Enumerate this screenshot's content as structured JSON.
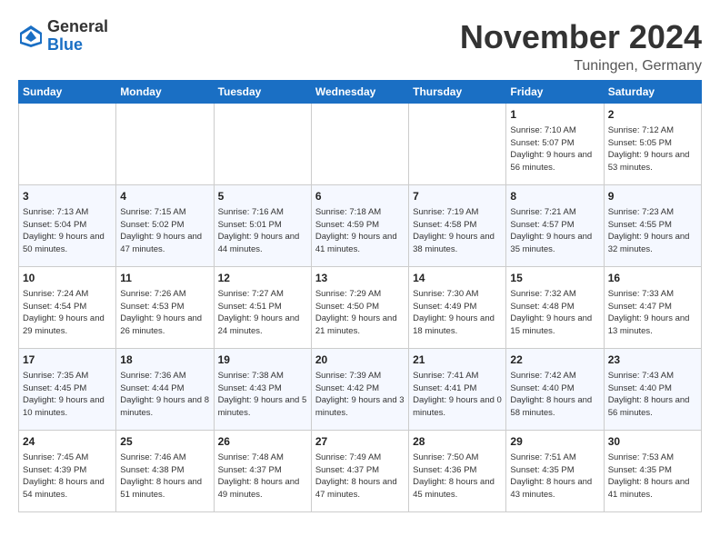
{
  "logo": {
    "general": "General",
    "blue": "Blue"
  },
  "title": "November 2024",
  "location": "Tuningen, Germany",
  "days_of_week": [
    "Sunday",
    "Monday",
    "Tuesday",
    "Wednesday",
    "Thursday",
    "Friday",
    "Saturday"
  ],
  "weeks": [
    [
      {
        "day": "",
        "info": ""
      },
      {
        "day": "",
        "info": ""
      },
      {
        "day": "",
        "info": ""
      },
      {
        "day": "",
        "info": ""
      },
      {
        "day": "",
        "info": ""
      },
      {
        "day": "1",
        "info": "Sunrise: 7:10 AM\nSunset: 5:07 PM\nDaylight: 9 hours and 56 minutes."
      },
      {
        "day": "2",
        "info": "Sunrise: 7:12 AM\nSunset: 5:05 PM\nDaylight: 9 hours and 53 minutes."
      }
    ],
    [
      {
        "day": "3",
        "info": "Sunrise: 7:13 AM\nSunset: 5:04 PM\nDaylight: 9 hours and 50 minutes."
      },
      {
        "day": "4",
        "info": "Sunrise: 7:15 AM\nSunset: 5:02 PM\nDaylight: 9 hours and 47 minutes."
      },
      {
        "day": "5",
        "info": "Sunrise: 7:16 AM\nSunset: 5:01 PM\nDaylight: 9 hours and 44 minutes."
      },
      {
        "day": "6",
        "info": "Sunrise: 7:18 AM\nSunset: 4:59 PM\nDaylight: 9 hours and 41 minutes."
      },
      {
        "day": "7",
        "info": "Sunrise: 7:19 AM\nSunset: 4:58 PM\nDaylight: 9 hours and 38 minutes."
      },
      {
        "day": "8",
        "info": "Sunrise: 7:21 AM\nSunset: 4:57 PM\nDaylight: 9 hours and 35 minutes."
      },
      {
        "day": "9",
        "info": "Sunrise: 7:23 AM\nSunset: 4:55 PM\nDaylight: 9 hours and 32 minutes."
      }
    ],
    [
      {
        "day": "10",
        "info": "Sunrise: 7:24 AM\nSunset: 4:54 PM\nDaylight: 9 hours and 29 minutes."
      },
      {
        "day": "11",
        "info": "Sunrise: 7:26 AM\nSunset: 4:53 PM\nDaylight: 9 hours and 26 minutes."
      },
      {
        "day": "12",
        "info": "Sunrise: 7:27 AM\nSunset: 4:51 PM\nDaylight: 9 hours and 24 minutes."
      },
      {
        "day": "13",
        "info": "Sunrise: 7:29 AM\nSunset: 4:50 PM\nDaylight: 9 hours and 21 minutes."
      },
      {
        "day": "14",
        "info": "Sunrise: 7:30 AM\nSunset: 4:49 PM\nDaylight: 9 hours and 18 minutes."
      },
      {
        "day": "15",
        "info": "Sunrise: 7:32 AM\nSunset: 4:48 PM\nDaylight: 9 hours and 15 minutes."
      },
      {
        "day": "16",
        "info": "Sunrise: 7:33 AM\nSunset: 4:47 PM\nDaylight: 9 hours and 13 minutes."
      }
    ],
    [
      {
        "day": "17",
        "info": "Sunrise: 7:35 AM\nSunset: 4:45 PM\nDaylight: 9 hours and 10 minutes."
      },
      {
        "day": "18",
        "info": "Sunrise: 7:36 AM\nSunset: 4:44 PM\nDaylight: 9 hours and 8 minutes."
      },
      {
        "day": "19",
        "info": "Sunrise: 7:38 AM\nSunset: 4:43 PM\nDaylight: 9 hours and 5 minutes."
      },
      {
        "day": "20",
        "info": "Sunrise: 7:39 AM\nSunset: 4:42 PM\nDaylight: 9 hours and 3 minutes."
      },
      {
        "day": "21",
        "info": "Sunrise: 7:41 AM\nSunset: 4:41 PM\nDaylight: 9 hours and 0 minutes."
      },
      {
        "day": "22",
        "info": "Sunrise: 7:42 AM\nSunset: 4:40 PM\nDaylight: 8 hours and 58 minutes."
      },
      {
        "day": "23",
        "info": "Sunrise: 7:43 AM\nSunset: 4:40 PM\nDaylight: 8 hours and 56 minutes."
      }
    ],
    [
      {
        "day": "24",
        "info": "Sunrise: 7:45 AM\nSunset: 4:39 PM\nDaylight: 8 hours and 54 minutes."
      },
      {
        "day": "25",
        "info": "Sunrise: 7:46 AM\nSunset: 4:38 PM\nDaylight: 8 hours and 51 minutes."
      },
      {
        "day": "26",
        "info": "Sunrise: 7:48 AM\nSunset: 4:37 PM\nDaylight: 8 hours and 49 minutes."
      },
      {
        "day": "27",
        "info": "Sunrise: 7:49 AM\nSunset: 4:37 PM\nDaylight: 8 hours and 47 minutes."
      },
      {
        "day": "28",
        "info": "Sunrise: 7:50 AM\nSunset: 4:36 PM\nDaylight: 8 hours and 45 minutes."
      },
      {
        "day": "29",
        "info": "Sunrise: 7:51 AM\nSunset: 4:35 PM\nDaylight: 8 hours and 43 minutes."
      },
      {
        "day": "30",
        "info": "Sunrise: 7:53 AM\nSunset: 4:35 PM\nDaylight: 8 hours and 41 minutes."
      }
    ]
  ]
}
